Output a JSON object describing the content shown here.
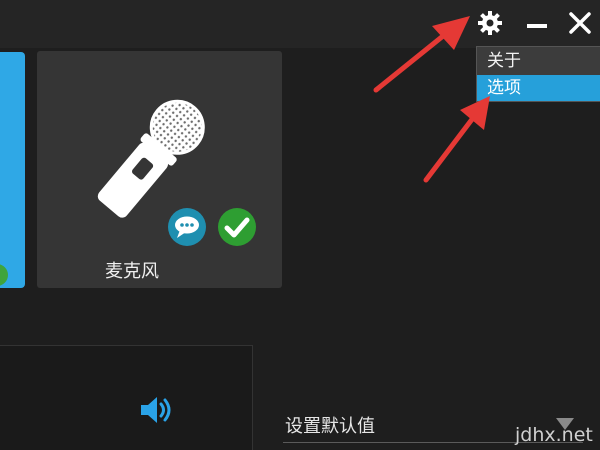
{
  "menu": {
    "items": [
      {
        "label": "关于",
        "active": false
      },
      {
        "label": "选项",
        "active": true
      }
    ]
  },
  "device": {
    "label": "麦克风",
    "icon": "microphone-icon"
  },
  "default_select": {
    "label": "设置默认值"
  },
  "watermark": "jdhx.net",
  "colors": {
    "accent": "#26a0da",
    "card": "#353535",
    "background": "#1e1e1e",
    "annotation_arrow": "#e53935",
    "success": "#2e9e32",
    "chat": "#1f8fb0"
  }
}
